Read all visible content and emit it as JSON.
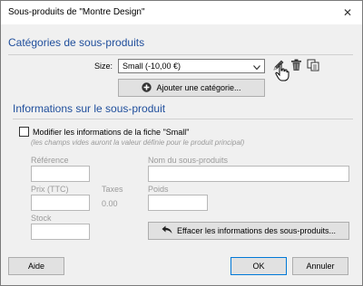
{
  "window": {
    "title": "Sous-produits de \"Montre Design\"",
    "close_glyph": "✕"
  },
  "categories": {
    "heading": "Catégories de sous-produits",
    "size_label": "Size:",
    "size_value": "Small (-10,00 €)",
    "add_button": "Ajouter une catégorie..."
  },
  "info": {
    "heading": "Informations sur le sous-produit",
    "modify_label": "Modifier les informations de la fiche \"Small\"",
    "modify_hint": "(les champs vides auront la valeur définie pour le produit principal)",
    "reference_label": "Référence",
    "name_label": "Nom du sous-produits",
    "price_label": "Prix (TTC)",
    "tax_label": "Taxes",
    "tax_value": "0.00",
    "weight_label": "Poids",
    "stock_label": "Stock",
    "clear_button": "Effacer les informations des sous-produits..."
  },
  "footer": {
    "help_button": "Aide",
    "ok_button": "OK",
    "cancel_button": "Annuler"
  },
  "icons": [
    "close-icon",
    "chevron-down-icon",
    "edit-pencil-icon",
    "trash-icon",
    "copy-icon",
    "plus-circle-icon",
    "undo-arrow-icon",
    "hand-cursor-icon"
  ]
}
